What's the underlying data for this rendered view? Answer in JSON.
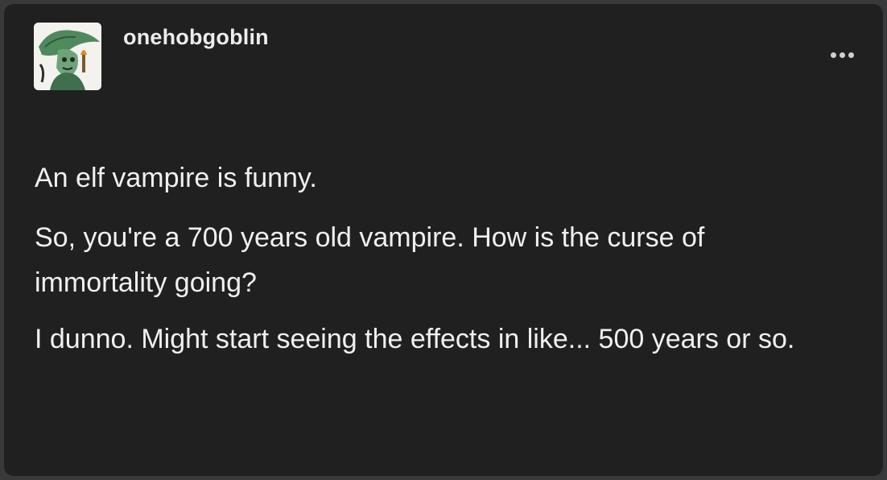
{
  "post": {
    "username": "onehobgoblin",
    "avatar_icon": "goblin-avatar-icon",
    "more_icon": "ellipsis-icon",
    "paragraphs": [
      "An elf vampire is funny.",
      "So, you're a 700 years old vampire. How is the curse of immortality going?",
      "I dunno. Might start seeing the effects in like... 500 years or so."
    ]
  },
  "colors": {
    "page_background": "#39393b",
    "post_background": "#202020",
    "text": "#f0f0f0",
    "username_text": "#ececec"
  }
}
